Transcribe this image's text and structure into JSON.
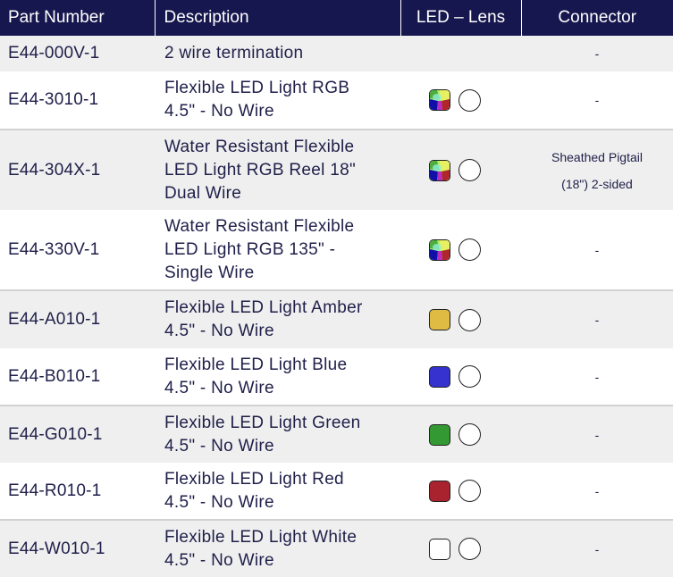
{
  "table": {
    "headers": {
      "part_number": "Part Number",
      "description": "Description",
      "led_lens": "LED – Lens",
      "connector": "Connector"
    },
    "rows": [
      {
        "part_number": "E44-000V-1",
        "description": "2 wire termination",
        "led": null,
        "lens": false,
        "connector": "-"
      },
      {
        "part_number": "E44-3010-1",
        "description": "Flexible LED Light RGB\n4.5\" - No Wire",
        "led": "rgb",
        "lens": true,
        "connector": "-"
      },
      {
        "part_number": "E44-304X-1",
        "description": "Water Resistant Flexible\nLED Light RGB Reel 18\"\nDual Wire",
        "led": "rgb",
        "lens": true,
        "connector": "Sheathed Pigtail\n(18\") 2-sided"
      },
      {
        "part_number": "E44-330V-1",
        "description": "Water Resistant Flexible\nLED Light RGB 135\" -\nSingle Wire",
        "led": "rgb",
        "lens": true,
        "connector": "-"
      },
      {
        "part_number": "E44-A010-1",
        "description": "Flexible LED Light Amber\n4.5\" - No Wire",
        "led": "amber",
        "lens": true,
        "connector": "-"
      },
      {
        "part_number": "E44-B010-1",
        "description": "Flexible LED Light Blue\n4.5\" - No Wire",
        "led": "blue",
        "lens": true,
        "connector": "-"
      },
      {
        "part_number": "E44-G010-1",
        "description": "Flexible LED Light Green\n4.5\" - No Wire",
        "led": "green",
        "lens": true,
        "connector": "-"
      },
      {
        "part_number": "E44-R010-1",
        "description": "Flexible LED Light Red\n4.5\" - No Wire",
        "led": "red",
        "lens": true,
        "connector": "-"
      },
      {
        "part_number": "E44-W010-1",
        "description": "Flexible LED Light White\n4.5\" - No Wire",
        "led": "white",
        "lens": true,
        "connector": "-"
      }
    ]
  },
  "led_colors": {
    "amber": "#e0bb44",
    "blue": "#3532cf",
    "green": "#339933",
    "red": "#a9232f",
    "white": "#ffffff",
    "rgb": [
      "#2a8f2a",
      "#a6f36a",
      "#e6f060",
      "#1010a8",
      "#b62dc0",
      "#b0262c",
      "#8ff0d6"
    ]
  },
  "colors": {
    "header_bg": "#17174f",
    "header_text": "#ffffff",
    "body_text": "#1f1f4a",
    "row_alt_bg": "#efefef",
    "row_bg": "#ffffff",
    "row_divider": "#d2d2d2"
  }
}
